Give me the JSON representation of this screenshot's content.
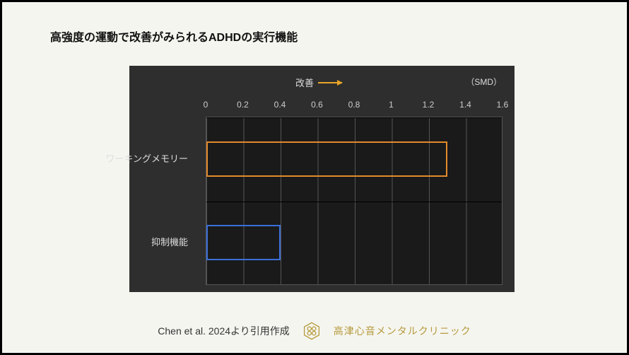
{
  "title": "高強度の運動で改善がみられるADHDの実行機能",
  "improve_label": "改善",
  "unit_label": "（SMD）",
  "footer_source": "Chen et al. 2024より引用作成",
  "footer_clinic": "高津心音メンタルクリニック",
  "chart_data": {
    "type": "bar",
    "orientation": "horizontal",
    "xlabel": "",
    "ylabel": "",
    "xlim": [
      0,
      1.6
    ],
    "ticks": [
      0,
      0.2,
      0.4,
      0.6,
      0.8,
      1,
      1.2,
      1.4,
      1.6
    ],
    "categories": [
      "ワーキングメモリー",
      "抑制機能"
    ],
    "values": [
      1.3,
      0.4
    ],
    "colors": [
      "#e38a2b",
      "#3b6fd8"
    ],
    "annotation": {
      "label": "改善",
      "direction": "right",
      "axis": "x"
    },
    "unit": "SMD"
  }
}
